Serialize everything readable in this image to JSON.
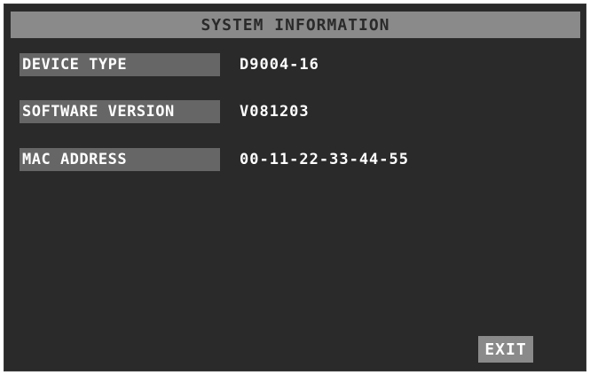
{
  "window": {
    "title": "SYSTEM INFORMATION"
  },
  "info": {
    "rows": [
      {
        "label": "DEVICE TYPE",
        "value": "D9004-16"
      },
      {
        "label": "SOFTWARE VERSION",
        "value": "V081203"
      },
      {
        "label": "MAC ADDRESS",
        "value": "00-11-22-33-44-55"
      }
    ]
  },
  "actions": {
    "exit_label": "EXIT"
  }
}
